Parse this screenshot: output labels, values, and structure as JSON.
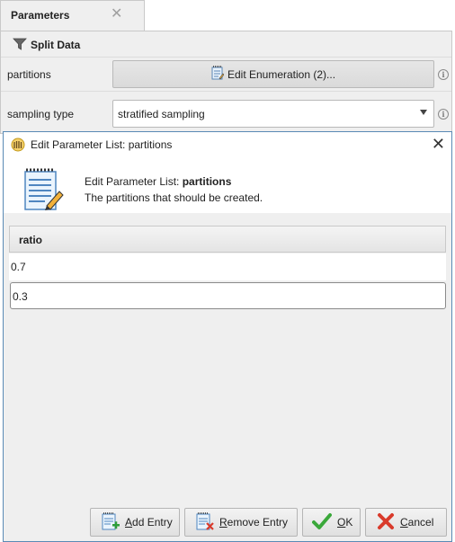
{
  "tab": {
    "title": "Parameters",
    "close_glyph": "✕"
  },
  "operator": {
    "name": "Split Data",
    "icon": "filter-icon"
  },
  "params": {
    "partitions": {
      "label": "partitions",
      "button_label": "Edit Enumeration (2)...",
      "icon": "notepad-icon"
    },
    "sampling_type": {
      "label": "sampling type",
      "value": "stratified sampling"
    }
  },
  "dialog": {
    "title": "Edit Parameter List: partitions",
    "close_glyph": "✕",
    "header_prefix": "Edit Parameter List: ",
    "header_param": "partitions",
    "description": "The partitions that should be created.",
    "table": {
      "column": "ratio",
      "rows": [
        "0.7",
        "0.3"
      ]
    },
    "buttons": {
      "add": {
        "mnemonic": "A",
        "rest": "dd Entry"
      },
      "remove": {
        "mnemonic": "R",
        "rest": "emove Entry"
      },
      "ok": {
        "mnemonic": "O",
        "rest": "K"
      },
      "cancel": {
        "mnemonic": "C",
        "rest": "ancel"
      }
    }
  },
  "colors": {
    "accent_border": "#5a8ab5",
    "ok_green": "#3aa83a",
    "cancel_red": "#d93a2b"
  }
}
